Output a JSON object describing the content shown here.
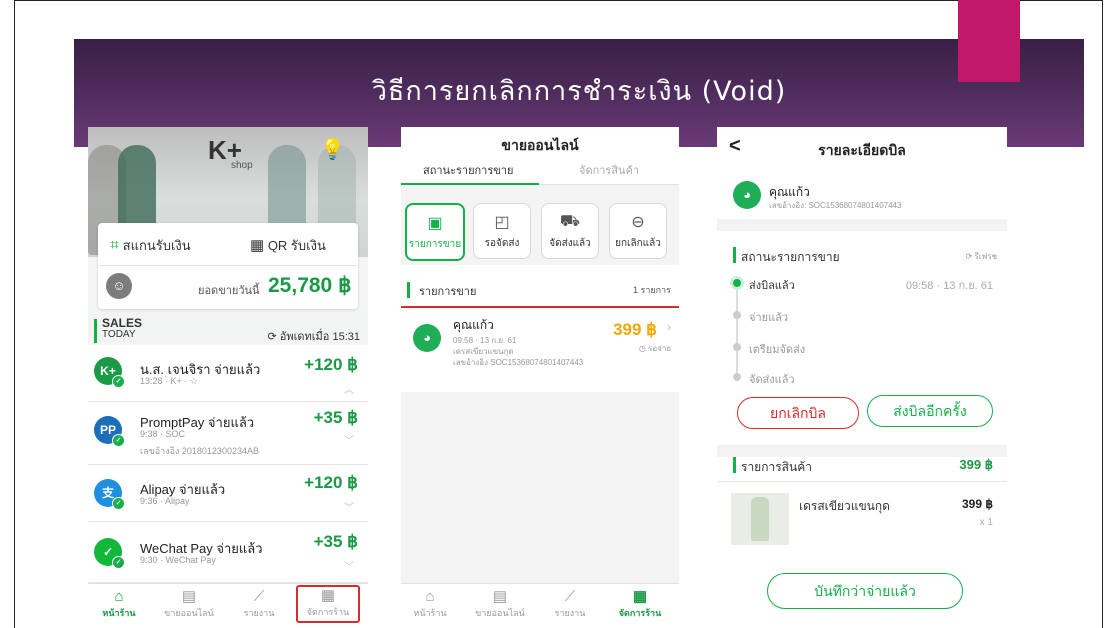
{
  "slide": {
    "title": "วิธีการยกเลิกการชำระเงิน (Void)"
  },
  "phone1": {
    "logo": "K+",
    "logo_sub": "shop",
    "scan_label": "สแกนรับเงิน",
    "qr_label": "QR รับเงิน",
    "today_sales_label": "ยอดขายวันนี้",
    "today_sales_value": "25,780 ฿",
    "sales_label": "SALES",
    "today_label": "TODAY",
    "updated_label": "อัพเดทเมื่อ 15:31",
    "transactions": [
      {
        "icon": "K+",
        "name": "น.ส. เจนจิรา จ่ายแล้ว",
        "sub": "13:28 · K+ · ☆",
        "ref": "",
        "amount": "+120 ฿",
        "color": "#1a9a46"
      },
      {
        "icon": "PP",
        "name": "PromptPay จ่ายแล้ว",
        "sub": "9:38 · SOC",
        "ref": "เลขอ้างอิง 2018012300234AB",
        "amount": "+35 ฿",
        "color": "#1b6fb8"
      },
      {
        "icon": "支",
        "name": "Alipay จ่ายแล้ว",
        "sub": "9:36 · Alipay",
        "ref": "",
        "amount": "+120 ฿",
        "color": "#1f8fe0"
      },
      {
        "icon": "✓",
        "name": "WeChat Pay จ่ายแล้ว",
        "sub": "9:30 · WeChat Pay",
        "ref": "",
        "amount": "+35 ฿",
        "color": "#12b83a"
      }
    ],
    "nav": [
      {
        "label": "หน้าร้าน",
        "icon": "⌂"
      },
      {
        "label": "ขายออนไลน์",
        "icon": "▤"
      },
      {
        "label": "รายงาน",
        "icon": "⟋"
      },
      {
        "label": "จัดการร้าน",
        "icon": "▦"
      }
    ]
  },
  "phone2": {
    "title": "ขายออนไลน์",
    "tab_status": "สถานะรายการขาย",
    "tab_products": "จัดการสินค้า",
    "status_buttons": [
      {
        "label": "รายการขาย",
        "icon": "▣"
      },
      {
        "label": "รอจัดส่ง",
        "icon": "◰"
      },
      {
        "label": "จัดส่งแล้ว",
        "icon": "⛟"
      },
      {
        "label": "ยกเลิกแล้ว",
        "icon": "⊖"
      }
    ],
    "list_header": "รายการขาย",
    "list_count": "1 รายการ",
    "order": {
      "name": "คุณแก้ว",
      "time": "09:58 · 13 ก.ย. 61",
      "item": "เดรสเขียวแขนกุด",
      "ref": "เลขอ้างอิง SOC15368074801407443",
      "amount": "399 ฿",
      "status": "รอจ่าย"
    },
    "nav": [
      {
        "label": "หน้าร้าน",
        "icon": "⌂"
      },
      {
        "label": "ขายออนไลน์",
        "icon": "▤"
      },
      {
        "label": "รายงาน",
        "icon": "⟋"
      },
      {
        "label": "จัดการร้าน",
        "icon": "▦"
      }
    ]
  },
  "phone3": {
    "title": "รายละเอียดบิล",
    "back": "<",
    "customer": "คุณแก้ว",
    "ref": "เลขอ้างอิง: SOC15368074801407443",
    "status_header": "สถานะรายการขาย",
    "refresh": "รีเฟรช",
    "timeline": [
      {
        "label": "ส่งบิลแล้ว",
        "time": "09:58 · 13 ก.ย. 61"
      },
      {
        "label": "จ่ายแล้ว",
        "time": ""
      },
      {
        "label": "เตรียมจัดส่ง",
        "time": ""
      },
      {
        "label": "จัดส่งแล้ว",
        "time": ""
      }
    ],
    "cancel_btn": "ยกเลิกบิล",
    "resend_btn": "ส่งบิลอีกครั้ง",
    "items_header": "รายการสินค้า",
    "items_total": "399 ฿",
    "item_name": "เดรสเขียวแขนกุด",
    "item_price": "399 ฿",
    "item_qty": "x 1",
    "save_btn": "บันทึกว่าจ่ายแล้ว"
  }
}
